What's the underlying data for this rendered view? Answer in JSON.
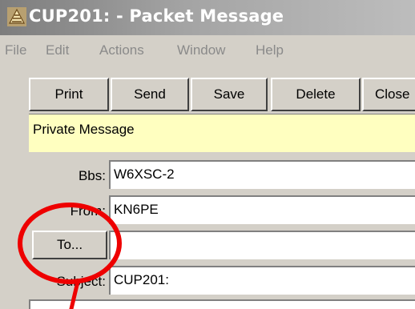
{
  "window": {
    "title": "CUP201: - Packet Message"
  },
  "menu": [
    "File",
    "Edit",
    "Actions",
    "Window",
    "Help"
  ],
  "toolbar": {
    "buttons": [
      "Print",
      "Send",
      "Save",
      "Delete",
      "Close"
    ]
  },
  "banner": {
    "text": "Private Message"
  },
  "form": {
    "bbs": {
      "label": "Bbs:",
      "value": "W6XSC-2"
    },
    "from": {
      "label": "From:",
      "value": "KN6PE"
    },
    "to": {
      "button_label": "To...",
      "value": ""
    },
    "subject": {
      "label": "Subject:",
      "value": "CUP201:"
    }
  },
  "colors": {
    "annotation": "#ee0000",
    "banner_bg": "#ffffc0",
    "title_bar": "#8a8a8a"
  },
  "icons": {
    "title": "app-icon"
  }
}
